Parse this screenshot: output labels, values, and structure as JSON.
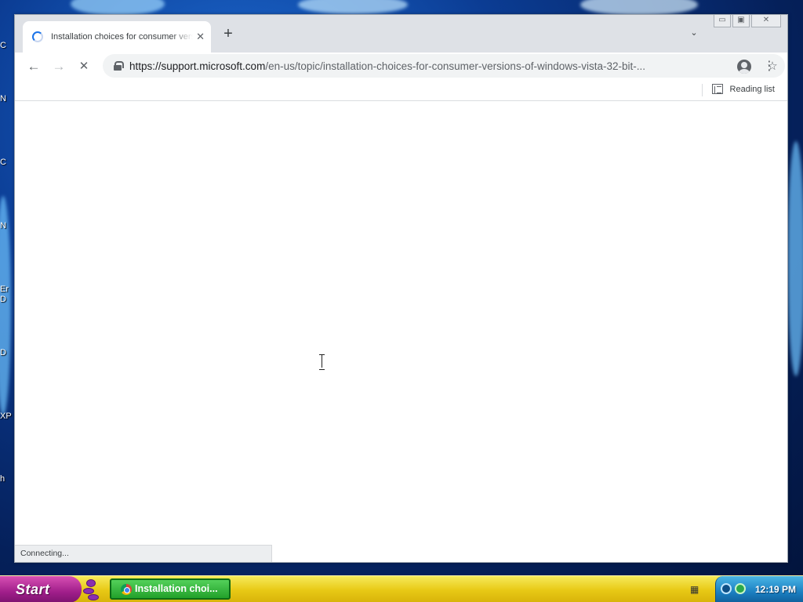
{
  "desktop": {
    "icon_labels": [
      "C",
      "N",
      "C",
      "N",
      "Er",
      "D",
      "D",
      "XP",
      "h"
    ]
  },
  "browser": {
    "tab": {
      "title": "Installation choices for consumer versions of Windows Vista",
      "close_glyph": "✕"
    },
    "new_tab_glyph": "+",
    "tab_search_glyph": "⌄",
    "window_controls": {
      "minimize": "▭",
      "restore": "▣",
      "close": "✕"
    },
    "toolbar": {
      "back_glyph": "←",
      "forward_glyph": "→",
      "stop_glyph": "✕",
      "url_host": "https://support.microsoft.com",
      "url_path": "/en-us/topic/installation-choices-for-consumer-versions-of-windows-vista-32-bit-...",
      "share_glyph": "⇪",
      "bookmark_glyph": "☆",
      "menu_glyph": "⋮"
    },
    "reading_list_label": "Reading list",
    "status_text": "Connecting..."
  },
  "taskbar": {
    "start_label": "Start",
    "task_label": "Installation choi...",
    "clock": "12:19 PM"
  },
  "colors": {
    "accent": "#1a73e8",
    "taskbar": "#e8c915",
    "start": "#a01e8a",
    "task_button": "#22a12a",
    "tray": "#1b7fc1"
  }
}
